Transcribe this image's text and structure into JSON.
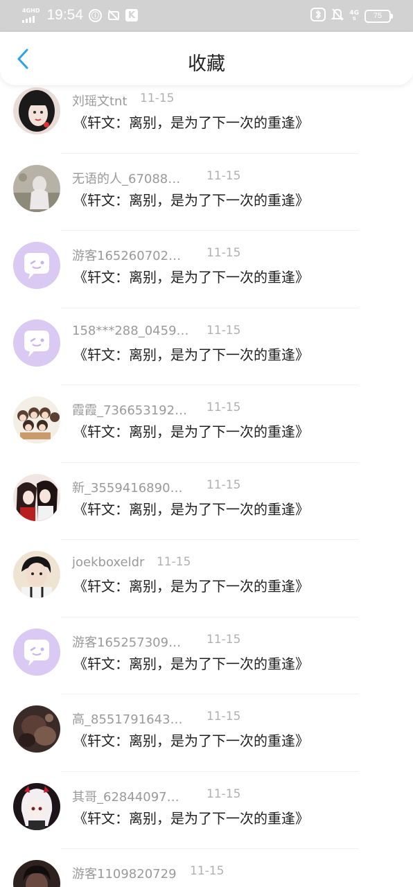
{
  "status_bar": {
    "network": "4GHD",
    "time": "19:54",
    "left_glyphs": [
      "circle-glyph",
      "camera-off-glyph",
      "k-glyph"
    ],
    "right_icons": [
      "bluetooth-icon",
      "bell-off-icon",
      "4g-signal-icon"
    ],
    "net_type": "4G",
    "battery": "75"
  },
  "header": {
    "title": "收藏",
    "back_icon": "chevron-left-icon",
    "accent_color": "#2aa3f0"
  },
  "list": [
    {
      "name": "刘瑶文tnt",
      "date": "11-15",
      "title": "《轩文：离别，是为了下一次的重逢》",
      "avatar": "photo-girl-dark-hair"
    },
    {
      "name": "无语的人_67088…",
      "date": "11-15",
      "title": "《轩文：离别，是为了下一次的重逢》",
      "avatar": "photo-outdoor-figure"
    },
    {
      "name": "游客165260702…",
      "date": "11-15",
      "title": "《轩文：离别，是为了下一次的重逢》",
      "avatar": "default-chat-bubble"
    },
    {
      "name": "158***288_0459…",
      "date": "11-15",
      "title": "《轩文：离别，是为了下一次的重逢》",
      "avatar": "default-chat-bubble"
    },
    {
      "name": "霞霞_736653192…",
      "date": "11-15",
      "title": "《轩文：离别，是为了下一次的重逢》",
      "avatar": "cartoon-group"
    },
    {
      "name": "新_3559416890…",
      "date": "11-15",
      "title": "《轩文：离别，是为了下一次的重逢》",
      "avatar": "anime-couple"
    },
    {
      "name": "joekboxeldr",
      "date": "11-15",
      "title": "《轩文：离别，是为了下一次的重逢》",
      "avatar": "photo-boy"
    },
    {
      "name": "游客165257309…",
      "date": "11-15",
      "title": "《轩文：离别，是为了下一次的重逢》",
      "avatar": "default-chat-bubble"
    },
    {
      "name": "高_8551791643…",
      "date": "11-15",
      "title": "《轩文：离别，是为了下一次的重逢》",
      "avatar": "photo-dark"
    },
    {
      "name": "其哥_62844097…",
      "date": "11-15",
      "title": "《轩文：离别，是为了下一次的重逢》",
      "avatar": "anime-white-hair"
    },
    {
      "name": "游客1109820729",
      "date": "11-15",
      "title": "",
      "avatar": "photo-dark-portrait"
    }
  ]
}
